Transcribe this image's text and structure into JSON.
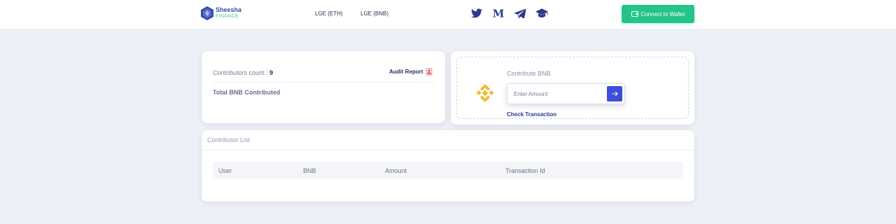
{
  "brand": {
    "name": "Sheesha",
    "sub": "FINANCE",
    "primary_color": "#3a4aa8",
    "accent_color": "#3cc89a"
  },
  "nav": {
    "links": [
      {
        "label": "LGE (ETH)"
      },
      {
        "label": "LGE (BNB)"
      }
    ],
    "social_icons": [
      "twitter-icon",
      "medium-icon",
      "telegram-icon",
      "graduation-cap-icon"
    ],
    "connect_label": "Connect to Wallet",
    "connect_color": "#25c48b"
  },
  "stats": {
    "contributors_label": "Contributors count : ",
    "contributors_value": "9",
    "audit_label": "Audit Report",
    "total_label": "Total BNB Contributed"
  },
  "contribute": {
    "title": "Contribute BNB",
    "amount_placeholder": "Enter Amount",
    "amount_value": "",
    "check_label": "Check Transaction",
    "button_color": "#3b4fd8",
    "bnb_color": "#f3ba2f"
  },
  "contributors_list": {
    "title": "Contributor List",
    "columns": [
      "User",
      "BNB",
      "Amount",
      "Transaction Id"
    ],
    "rows": []
  }
}
